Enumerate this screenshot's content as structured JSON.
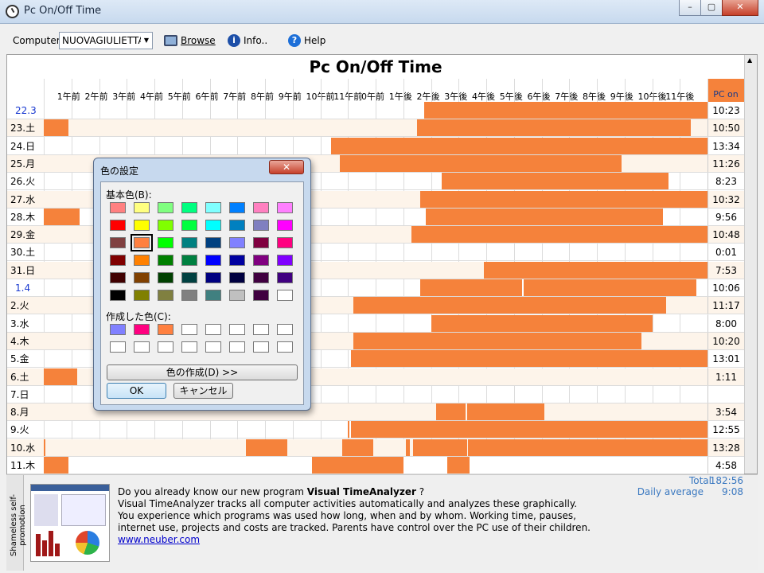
{
  "window": {
    "title": "Pc On/Off Time",
    "buttons": [
      "–",
      "▢",
      "✕"
    ]
  },
  "toolbar": {
    "computer_label": "Computer",
    "computer_value": "NUOVAGIULIETTA",
    "browse_label": "Browse",
    "info_label": "Info..",
    "help_label": "Help"
  },
  "grid": {
    "title": "Pc On/Off Time",
    "pcon_header": "PC on",
    "hour_labels": [
      "1午前",
      "2午前",
      "3午前",
      "4午前",
      "5午前",
      "6午前",
      "7午前",
      "8午前",
      "9午前",
      "10午前",
      "11午前",
      "0午前",
      "1午後",
      "2午後",
      "3午後",
      "4午後",
      "5午後",
      "6午後",
      "7午後",
      "8午後",
      "9午後",
      "10午後",
      "11午後"
    ],
    "rows": [
      {
        "label": "22.3",
        "blue": true,
        "total": "10:23",
        "bars": [
          [
            13.75,
            24
          ]
        ]
      },
      {
        "label": "23.土",
        "total": "10:50",
        "bars": [
          [
            0,
            0.9
          ],
          [
            13.5,
            23.4
          ]
        ]
      },
      {
        "label": "24.日",
        "total": "13:34",
        "bars": [
          [
            10.4,
            24
          ]
        ]
      },
      {
        "label": "25.月",
        "total": "11:26",
        "bars": [
          [
            10.7,
            20.9
          ]
        ]
      },
      {
        "label": "26.火",
        "total": "8:23",
        "bars": [
          [
            14.4,
            22.6
          ]
        ]
      },
      {
        "label": "27.水",
        "total": "10:32",
        "bars": [
          [
            13.6,
            24
          ]
        ]
      },
      {
        "label": "28.木",
        "total": "9:56",
        "bars": [
          [
            0,
            1.3
          ],
          [
            13.8,
            22.4
          ]
        ]
      },
      {
        "label": "29.金",
        "total": "10:48",
        "bars": [
          [
            13.3,
            24
          ]
        ]
      },
      {
        "label": "30.土",
        "total": "0:01",
        "bars": []
      },
      {
        "label": "31.日",
        "total": "7:53",
        "bars": [
          [
            15.9,
            24
          ]
        ]
      },
      {
        "label": "1.4",
        "blue": true,
        "total": "10:06",
        "bars": [
          [
            13.6,
            17.3
          ],
          [
            17.35,
            23.6
          ]
        ]
      },
      {
        "label": "2.火",
        "total": "11:17",
        "bars": [
          [
            11.2,
            22.5
          ]
        ]
      },
      {
        "label": "3.水",
        "total": "8:00",
        "bars": [
          [
            14,
            22
          ]
        ]
      },
      {
        "label": "4.木",
        "total": "10:20",
        "bars": [
          [
            11.2,
            21.6
          ]
        ]
      },
      {
        "label": "5.金",
        "total": "13:01",
        "bars": [
          [
            11.1,
            24
          ]
        ]
      },
      {
        "label": "6.土",
        "total": "1:11",
        "bars": [
          [
            0,
            1.2
          ]
        ]
      },
      {
        "label": "7.日",
        "total": "",
        "bars": []
      },
      {
        "label": "8.月",
        "total": "3:54",
        "bars": [
          [
            14.2,
            15.25
          ],
          [
            15.3,
            18.1
          ]
        ]
      },
      {
        "label": "9.火",
        "total": "12:55",
        "bars": [
          [
            11,
            11.05
          ],
          [
            11.1,
            24
          ]
        ]
      },
      {
        "label": "10.水",
        "total": "13:28",
        "bars": [
          [
            0,
            0.05
          ],
          [
            7.3,
            8.8
          ],
          [
            10.8,
            11.9
          ],
          [
            13.1,
            13.25
          ],
          [
            13.35,
            15.3
          ],
          [
            15.35,
            24
          ]
        ]
      },
      {
        "label": "11.木",
        "total": "4:58",
        "bars": [
          [
            0,
            0.9
          ],
          [
            9.7,
            13
          ],
          [
            14.6,
            15.4
          ]
        ]
      }
    ],
    "totals": {
      "total_label": "Total",
      "total_value": "182:56",
      "avg_label": "Daily average",
      "avg_value": "9:08"
    }
  },
  "promo": {
    "side_tag": "Shameless self-promotion",
    "line1_pre": "Do you already know our new program ",
    "line1_bold": "Visual TimeAnalyzer",
    "line1_post": " ?",
    "line2": "Visual TimeAnalyzer tracks all computer activities automatically and analyzes these graphically.",
    "line3": "You experience which programs was used how long, when and by whom. Working time, pauses,",
    "line4": "internet use, projects and costs are tracked. Parents have control over the PC use of their children.",
    "link": "www.neuber.com"
  },
  "dialog": {
    "title": "色の設定",
    "basic_label": "基本色(B):",
    "custom_label": "作成した色(C):",
    "define_button": "色の作成(D) >>",
    "ok_button": "OK",
    "cancel_button": "キャンセル",
    "basic_colors": [
      [
        "#ff8080",
        "#ffff80",
        "#80ff80",
        "#00ff80",
        "#80ffff",
        "#0080ff",
        "#ff80c0",
        "#ff80ff"
      ],
      [
        "#ff0000",
        "#ffff00",
        "#80ff00",
        "#00ff40",
        "#00ffff",
        "#0080c0",
        "#8080c0",
        "#ff00ff"
      ],
      [
        "#804040",
        "#ff8040",
        "#00ff00",
        "#008080",
        "#004080",
        "#8080ff",
        "#800040",
        "#ff0080"
      ],
      [
        "#800000",
        "#ff8000",
        "#008000",
        "#008040",
        "#0000ff",
        "#0000a0",
        "#800080",
        "#8000ff"
      ],
      [
        "#400000",
        "#804000",
        "#004000",
        "#004040",
        "#000080",
        "#000040",
        "#400040",
        "#400080"
      ],
      [
        "#000000",
        "#808000",
        "#808040",
        "#808080",
        "#408080",
        "#c0c0c0",
        "#400040",
        "#ffffff"
      ]
    ],
    "custom_colors": [
      [
        "#8080ff",
        "#ff0080",
        "#ff8040",
        "#ffffff",
        "#ffffff",
        "#ffffff",
        "#ffffff",
        "#ffffff"
      ],
      [
        "#ffffff",
        "#ffffff",
        "#ffffff",
        "#ffffff",
        "#ffffff",
        "#ffffff",
        "#ffffff",
        "#ffffff"
      ]
    ],
    "selected_basic": [
      2,
      1
    ]
  },
  "colors": {
    "bar": "#f5823b",
    "blue_date": "#1a3ad0"
  }
}
